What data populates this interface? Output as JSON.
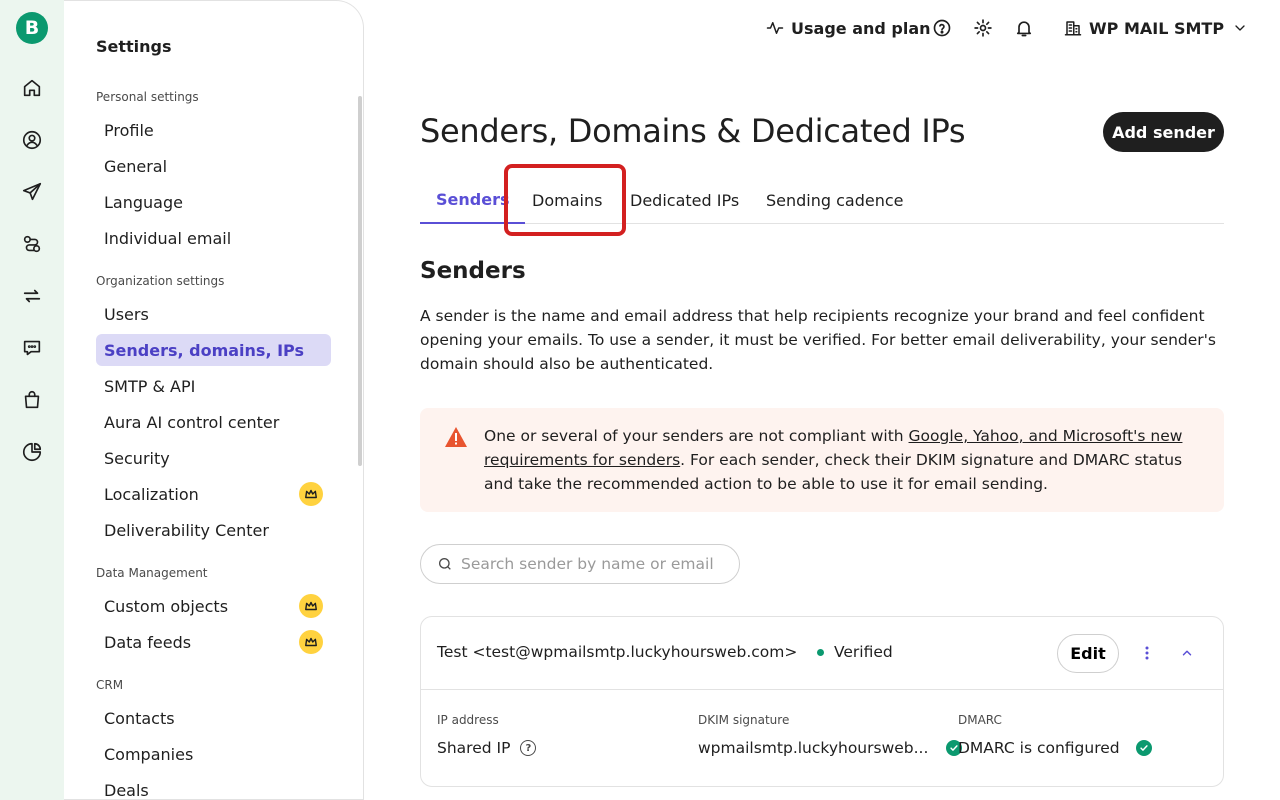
{
  "logo": {
    "letter": "B"
  },
  "rail": {
    "icons": [
      "home-icon",
      "contacts-icon",
      "campaigns-icon",
      "automations-icon",
      "sync-icon",
      "conversations-icon",
      "shop-icon",
      "reports-icon"
    ]
  },
  "sidebar": {
    "title": "Settings",
    "sections": [
      {
        "label": "Personal settings"
      },
      {
        "label": "Organization settings"
      },
      {
        "label": "Data Management"
      },
      {
        "label": "CRM"
      }
    ],
    "personal": [
      "Profile",
      "General",
      "Language",
      "Individual email"
    ],
    "organization": [
      "Users",
      "Senders, domains, IPs",
      "SMTP & API",
      "Aura AI control center",
      "Security",
      "Localization",
      "Deliverability Center"
    ],
    "data_management": [
      "Custom objects",
      "Data feeds"
    ],
    "crm": [
      "Contacts",
      "Companies",
      "Deals"
    ]
  },
  "topbar": {
    "usage": "Usage and plan",
    "account": "WP MAIL SMTP"
  },
  "main": {
    "title": "Senders, Domains & Dedicated IPs",
    "add_sender": "Add sender",
    "tabs": [
      "Senders",
      "Domains",
      "Dedicated IPs",
      "Sending cadence"
    ],
    "section_title": "Senders",
    "description": "A sender is the name and email address that help recipients recognize your brand and feel confident opening your emails. To use a sender, it must be verified. For better email deliverability, your sender's domain should also be authenticated.",
    "alert": {
      "before": "One or several of your senders are not compliant with ",
      "link": "Google, Yahoo, and Microsoft's new requirements for senders",
      "after": ". For each sender, check their DKIM signature and DMARC status and take the recommended action to be able to use it for email sending."
    },
    "search_placeholder": "Search sender by name or email",
    "sender": {
      "name": "Test <test@wpmailsmtp.luckyhoursweb.com>",
      "status": "Verified",
      "edit": "Edit",
      "ip_label": "IP address",
      "ip_value": "Shared IP",
      "dkim_label": "DKIM signature",
      "dkim_value": "wpmailsmtp.luckyhoursweb...",
      "dmarc_label": "DMARC",
      "dmarc_value": "DMARC is configured"
    }
  },
  "colors": {
    "brand": "#0b996f",
    "accent": "#5a4fd6",
    "highlight": "#d32020",
    "premium": "#ffd23f"
  }
}
